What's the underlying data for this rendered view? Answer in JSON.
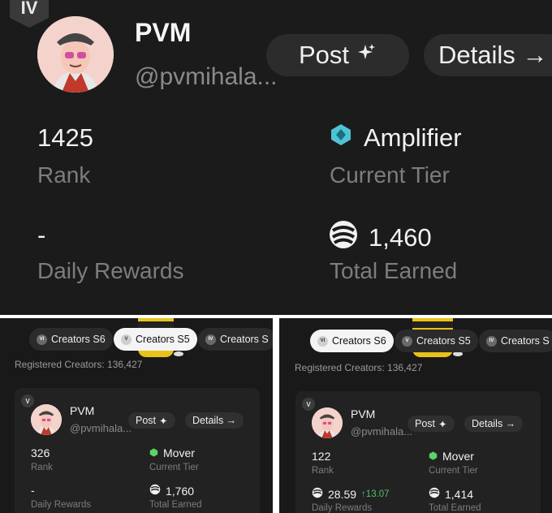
{
  "top": {
    "tier_badge": "IV",
    "name": "PVM",
    "handle": "@pvmihala...",
    "post_label": "Post",
    "details_label": "Details →",
    "rank_value": "1425",
    "rank_label": "Rank",
    "tier_value": "Amplifier",
    "tier_label": "Current Tier",
    "daily_value": "-",
    "daily_label": "Daily Rewards",
    "earned_value": "1,460",
    "earned_label": "Total Earned"
  },
  "left_panel": {
    "tabs": [
      "Creators S6",
      "Creators S5",
      "Creators S"
    ],
    "tab_icons": [
      "VI",
      "V",
      "IV"
    ],
    "active_tab": "Creators S5",
    "registered": "Registered Creators: 136,427",
    "tier_badge": "V",
    "name": "PVM",
    "handle": "@pvmihala...",
    "post_label": "Post",
    "details_label": "Details →",
    "rank_value": "326",
    "rank_label": "Rank",
    "tier_value": "Mover",
    "tier_label": "Current Tier",
    "daily_value": "-",
    "daily_label": "Daily Rewards",
    "earned_value": "1,760",
    "earned_label": "Total Earned"
  },
  "right_panel": {
    "tabs": [
      "Creators S6",
      "Creators S5",
      "Creators S"
    ],
    "tab_icons": [
      "VI",
      "V",
      "IV"
    ],
    "active_tab": "Creators S6",
    "registered": "Registered Creators: 136,427",
    "tier_badge": "V",
    "name": "PVM",
    "handle": "@pvmihala...",
    "post_label": "Post",
    "details_label": "Details →",
    "rank_value": "122",
    "rank_label": "Rank",
    "tier_value": "Mover",
    "tier_label": "Current Tier",
    "daily_value": "28.59",
    "daily_delta": "↑13.07",
    "daily_label": "Daily Rewards",
    "earned_value": "1,414",
    "earned_label": "Total Earned"
  },
  "colors": {
    "amplifier_gem": "#4fc3d6",
    "mover_gem": "#5cd36a",
    "delta_green": "#4cc46c",
    "bee_yellow": "#e8c21a"
  },
  "icons": [
    "sparkle-icon",
    "arrow-right-icon",
    "gem-icon",
    "coin-icon",
    "avatar",
    "bee-mascot"
  ]
}
